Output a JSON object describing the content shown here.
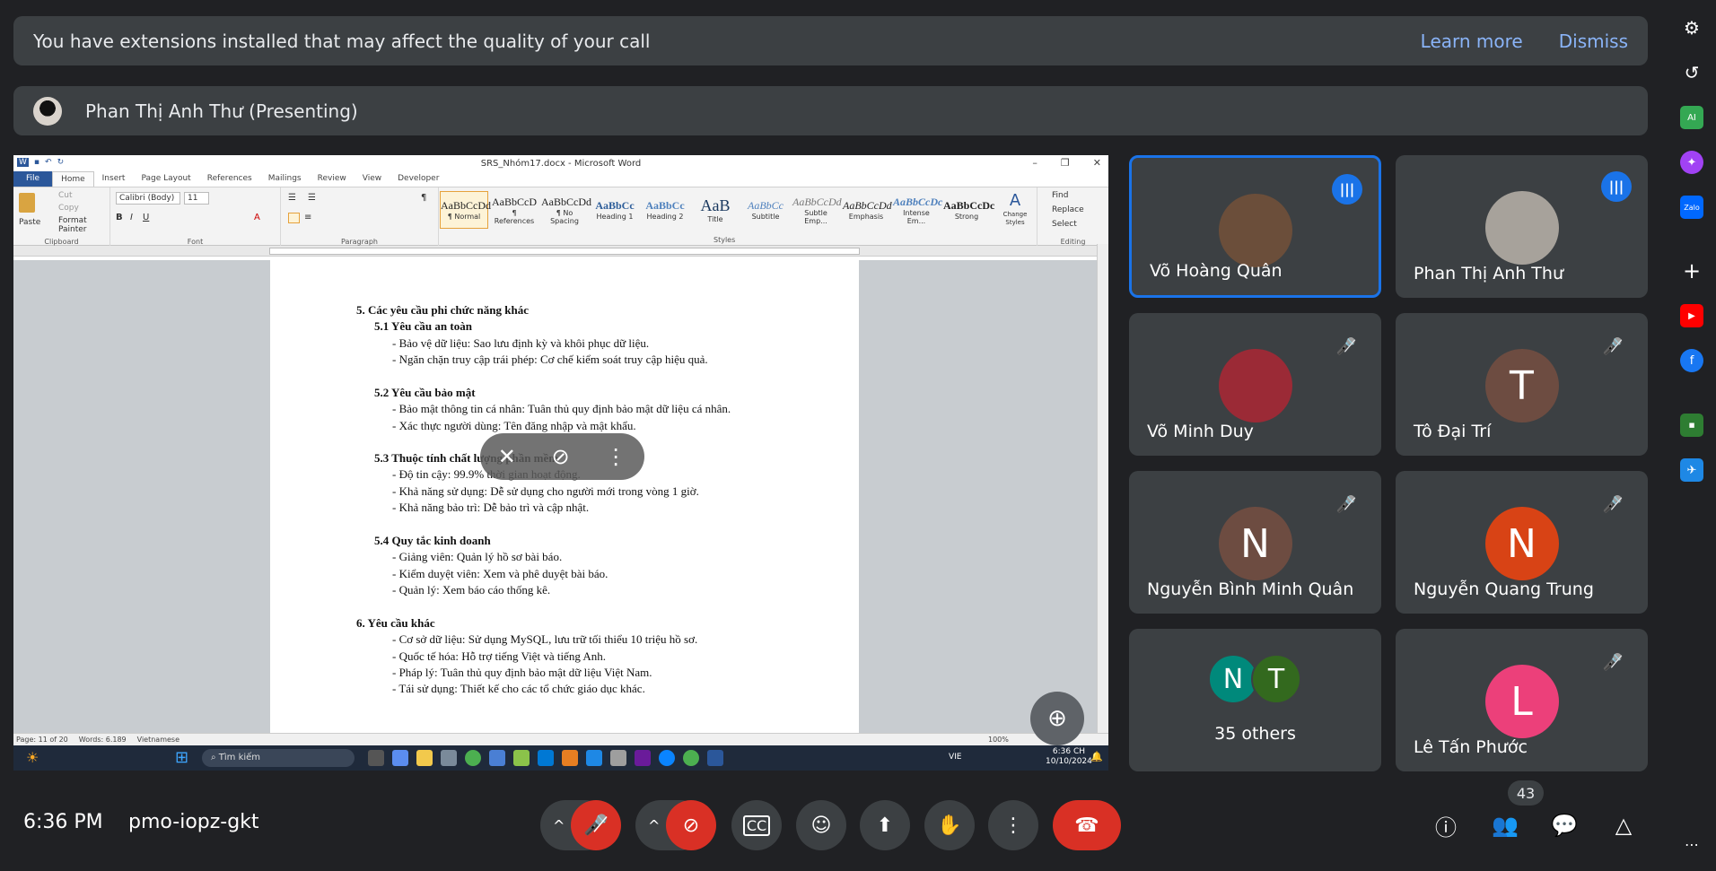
{
  "banner": {
    "message": "You have extensions installed that may affect the quality of your call",
    "learn_more": "Learn more",
    "dismiss": "Dismiss"
  },
  "presenter": {
    "name": "Phan Thị Anh Thư (Presenting)"
  },
  "word": {
    "window_title": "SRS_Nhóm17.docx - Microsoft Word",
    "tabs": [
      "File",
      "Home",
      "Insert",
      "Page Layout",
      "References",
      "Mailings",
      "Review",
      "View",
      "Developer"
    ],
    "clipboard": {
      "paste": "Paste",
      "cut": "Cut",
      "copy": "Copy",
      "format_painter": "Format Painter",
      "label": "Clipboard"
    },
    "font": {
      "name": "Calibri (Body)",
      "size": "11",
      "label": "Font"
    },
    "paragraph_label": "Paragraph",
    "styles": [
      {
        "preview": "AaBbCcDd",
        "name": "¶ Normal"
      },
      {
        "preview": "AaBbCcD",
        "name": "¶ References"
      },
      {
        "preview": "AaBbCcDd",
        "name": "¶ No Spacing"
      },
      {
        "preview": "AaBbCc",
        "name": "Heading 1"
      },
      {
        "preview": "AaBbCc",
        "name": "Heading 2"
      },
      {
        "preview": "AaB",
        "name": "Title"
      },
      {
        "preview": "AaBbCc",
        "name": "Subtitle"
      },
      {
        "preview": "AaBbCcDd",
        "name": "Subtle Emp..."
      },
      {
        "preview": "AaBbCcDd",
        "name": "Emphasis"
      },
      {
        "preview": "AaBbCcDc",
        "name": "Intense Em..."
      },
      {
        "preview": "AaBbCcDc",
        "name": "Strong"
      }
    ],
    "styles_label": "Styles",
    "change_styles": "Change Styles",
    "editing": {
      "find": "Find",
      "replace": "Replace",
      "select": "Select",
      "label": "Editing"
    },
    "doc": {
      "h5": "5.   Các yêu cầu phi chức năng khác",
      "h51": "5.1 Yêu cầu an toàn",
      "l511": "-    Bảo vệ dữ liệu: Sao lưu định kỳ và khôi phục dữ liệu.",
      "l512": "-    Ngăn chặn truy cập trái phép: Cơ chế kiểm soát truy cập hiệu quả.",
      "h52": "5.2 Yêu cầu bảo mật",
      "l521": "-    Bảo mật thông tin cá nhân: Tuân thủ quy định bảo mật dữ liệu cá nhân.",
      "l522": "-    Xác thực người dùng: Tên đăng nhập và mật khẩu.",
      "h53": "5.3 Thuộc tính chất lượng phần mềm",
      "l531": "-    Độ tin cậy: 99.9% thời gian hoạt động.",
      "l532": "-    Khả năng sử dụng: Dễ sử dụng cho người mới trong vòng 1 giờ.",
      "l533": "-    Khả năng bảo trì: Dễ bảo trì và cập nhật.",
      "h54": "5.4 Quy tắc kinh doanh",
      "l541": "-    Giảng viên: Quản lý hồ sơ bài báo.",
      "l542": "-    Kiểm duyệt viên: Xem và phê duyệt bài báo.",
      "l543": "-    Quản lý: Xem báo cáo thống kê.",
      "h6": "6.   Yêu cầu khác",
      "l61": "-    Cơ sở dữ liệu: Sử dụng MySQL, lưu trữ tối thiểu 10 triệu hồ sơ.",
      "l62": "-    Quốc tế hóa: Hỗ trợ tiếng Việt và tiếng Anh.",
      "l63": "-    Pháp lý: Tuân thủ quy định bảo mật dữ liệu Việt Nam.",
      "l64": "-    Tái sử dụng: Thiết kế cho các tổ chức giáo dục khác."
    },
    "status": {
      "page": "Page: 11 of 20",
      "words": "Words: 6.189",
      "language": "Vietnamese",
      "zoom": "100%"
    },
    "taskbar": {
      "search": "Tìm kiếm",
      "lang": "VIE",
      "time": "6:36 CH",
      "date": "10/10/2024"
    }
  },
  "participants": [
    {
      "name": "Võ Hoàng Quân",
      "initial": "",
      "color": "#6b4e3a",
      "speaking": true,
      "active": true
    },
    {
      "name": "Phan Thị Anh Thư",
      "initial": "",
      "color": "#a7a29b",
      "speaking": true,
      "active": false
    },
    {
      "name": "Võ Minh Duy",
      "initial": "",
      "color": "#9b2a36",
      "speaking": false,
      "active": false
    },
    {
      "name": "Tô Đại Trí",
      "initial": "T",
      "color": "#6d4c41",
      "speaking": false,
      "active": false
    },
    {
      "name": "Nguyễn Bình Minh Quân",
      "initial": "N",
      "color": "#6d4c41",
      "speaking": false,
      "active": false
    },
    {
      "name": "Nguyễn Quang Trung",
      "initial": "N",
      "color": "#d84315",
      "speaking": false,
      "active": false
    },
    {
      "name": "Lê Tấn Phước",
      "initial": "L",
      "color": "#ec407a",
      "speaking": false,
      "active": false
    }
  ],
  "others": {
    "label": "35 others",
    "a": "N",
    "b": "T",
    "color_a": "#00897b",
    "color_b": "#33691e"
  },
  "bottom": {
    "time": "6:36 PM",
    "meeting_code": "pmo-iopz-gkt",
    "people_count": "43"
  }
}
